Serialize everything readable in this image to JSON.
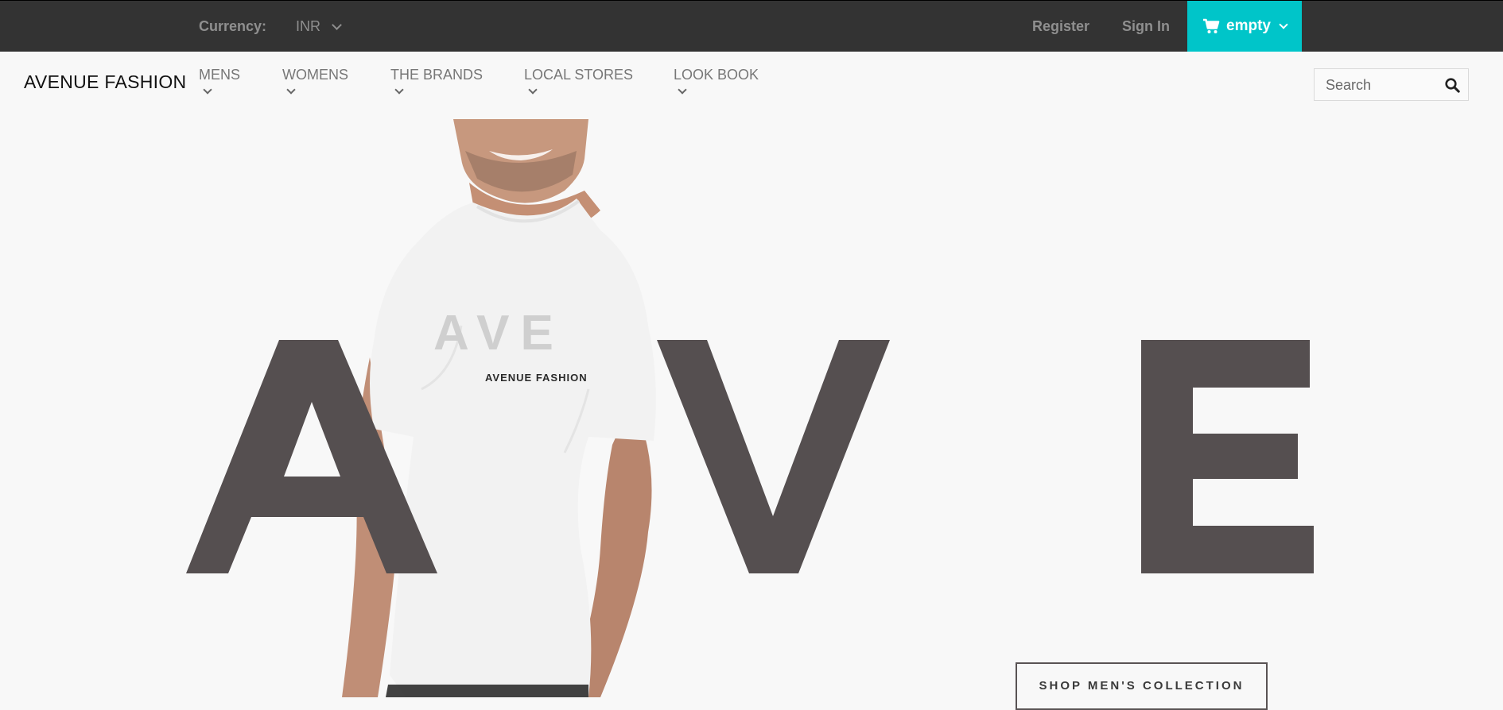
{
  "colors": {
    "topbar_bg": "#333333",
    "accent": "#00c5c9",
    "hero_letters": "#554f50",
    "page_bg": "#f8f8f8"
  },
  "topbar": {
    "currency_label": "Currency:",
    "currency_value": "INR",
    "register": "Register",
    "sign_in": "Sign In",
    "cart_label": "empty",
    "cart_icon": "cart-icon"
  },
  "header": {
    "brand": "AVENUE FASHION",
    "nav": [
      {
        "label": "MENS"
      },
      {
        "label": "WOMENS"
      },
      {
        "label": "THE BRANDS"
      },
      {
        "label": "LOCAL STORES"
      },
      {
        "label": "LOOK BOOK"
      }
    ],
    "search_placeholder": "Search",
    "search_icon": "search-icon"
  },
  "hero": {
    "letters": [
      "A",
      "V",
      "E"
    ],
    "shirt_letters": "AVE",
    "shirt_print": "AVENUE FASHION",
    "cta_label": "SHOP MEN'S COLLECTION"
  }
}
